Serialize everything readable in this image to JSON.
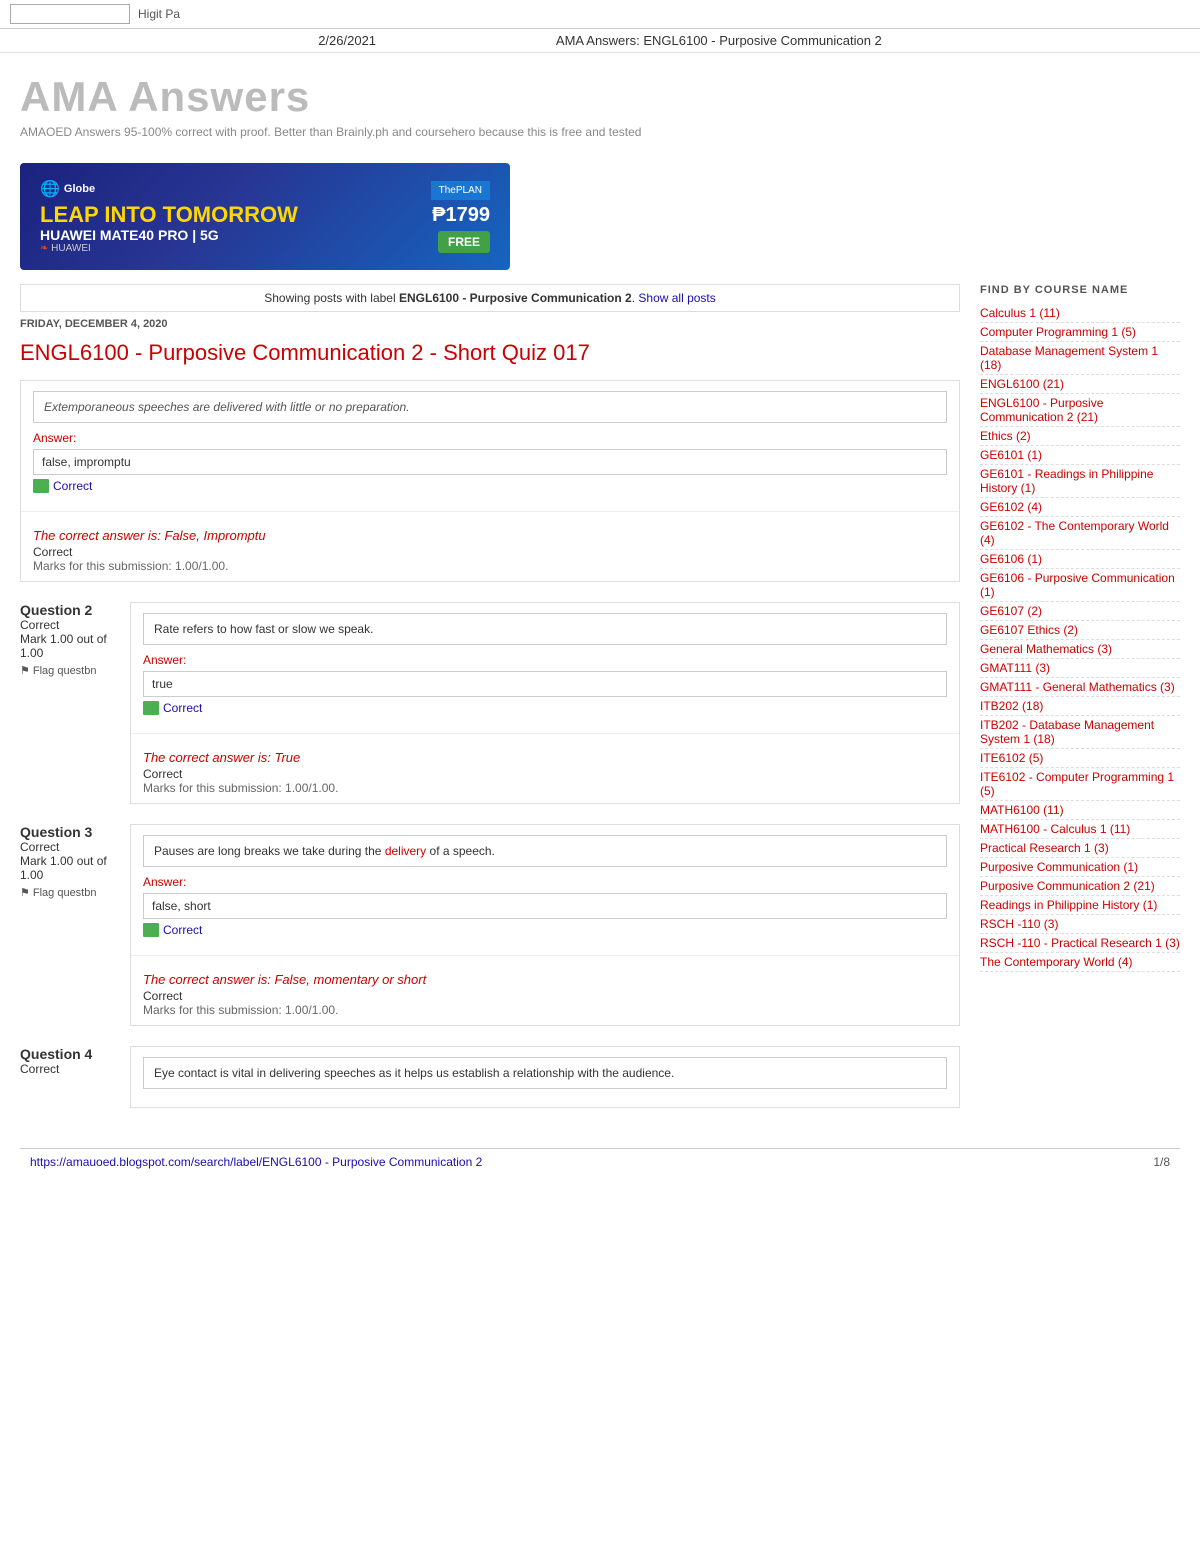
{
  "browser": {
    "title": "AMA Answers: ENGL6100 - Purposive Communication 2",
    "date": "2/26/2021",
    "url": "https://amauoed.blogspot.com/search/label/ENGL6100 - Purposive Communication 2",
    "page_num": "1/8"
  },
  "topbar": {
    "input_placeholder": "",
    "higit_pa": "Higit Pa"
  },
  "site": {
    "title": "AMA Answers",
    "subtitle": "AMAOED Answers 95-100% correct with proof. Better than Brainly.ph and coursehero because this is free and tested"
  },
  "ad": {
    "globe": "Globe",
    "huawei": "HUAWEI",
    "main_text": "LEAP INTO TOMORROW",
    "sub_text": "HUAWEI MATE40 PRO | 5G",
    "plan_label": "ThePLAN",
    "price": "₱1799",
    "free": "FREE"
  },
  "label_bar": {
    "text": "Showing posts with label",
    "label": "ENGL6100 - Purposive Communication 2",
    "show_all": "Show all posts"
  },
  "post_date": "FRIDAY, DECEMBER 4, 2020",
  "post_title": "ENGL6100 - Purposive Communication 2 - Short Quiz 017",
  "questions": [
    {
      "id": "q1",
      "num": null,
      "status": null,
      "marks": null,
      "flag": null,
      "text": "Extemporaneous speeches are delivered with little or no preparation.",
      "text_italic": true,
      "answer_label": "Answer:",
      "answer_value": "false, impromptu",
      "correct_icon": true,
      "correct_answer": "The correct answer is: False, Impromptu",
      "correct_word": "Correct",
      "marks_submission": "Marks for this submission: 1.00/1.00."
    },
    {
      "id": "q2",
      "num": "Question 2",
      "status": "Correct",
      "marks": "Mark 1.00 out of 1.00",
      "flag": "Flag questbn",
      "text": "Rate refers to how fast or slow we speak.",
      "text_italic": false,
      "answer_label": "Answer:",
      "answer_value": "true",
      "correct_icon": true,
      "correct_answer": "The correct answer is: True",
      "correct_word": "Correct",
      "marks_submission": "Marks for this submission: 1.00/1.00."
    },
    {
      "id": "q3",
      "num": "Question 3",
      "status": "Correct",
      "marks": "Mark 1.00 out of 1.00",
      "flag": "Flag questbn",
      "text_parts": [
        "Pauses are long breaks we take during the ",
        "delivery",
        " of a speech."
      ],
      "has_highlight": true,
      "answer_label": "Answer:",
      "answer_value": "false, short",
      "correct_icon": true,
      "correct_answer": "The correct answer is: False, momentary or short",
      "correct_word": "Correct",
      "marks_submission": "Marks for this submission: 1.00/1.00."
    },
    {
      "id": "q4",
      "num": "Question 4",
      "status": "Correct",
      "marks": null,
      "flag": null,
      "text": "Eye contact is vital in delivering speeches as it helps us establish a relationship with the audience.",
      "answer_label": null,
      "answer_value": null,
      "correct_icon": false
    }
  ],
  "sidebar": {
    "title": "FIND BY COURSE NAME",
    "links": [
      {
        "label": "Calculus 1 (11)"
      },
      {
        "label": "Computer Programming 1 (5)"
      },
      {
        "label": "Database Management System 1 (18)"
      },
      {
        "label": "ENGL6100 (21)"
      },
      {
        "label": "ENGL6100 - Purposive Communication 2 (21)"
      },
      {
        "label": "Ethics (2)"
      },
      {
        "label": "GE6101 (1)"
      },
      {
        "label": "GE6101 - Readings in Philippine History (1)"
      },
      {
        "label": "GE6102 (4)"
      },
      {
        "label": "GE6102 - The Contemporary World (4)"
      },
      {
        "label": "GE6106 (1)"
      },
      {
        "label": "GE6106 - Purposive Communication (1)"
      },
      {
        "label": "GE6107 (2)"
      },
      {
        "label": "GE6107 Ethics (2)"
      },
      {
        "label": "General Mathematics (3)"
      },
      {
        "label": "GMAT111 (3)"
      },
      {
        "label": "GMAT111 - General Mathematics (3)"
      },
      {
        "label": "ITB202 (18)"
      },
      {
        "label": "ITB202 - Database Management System 1 (18)"
      },
      {
        "label": "ITE6102 (5)"
      },
      {
        "label": "ITE6102 - Computer Programming 1 (5)"
      },
      {
        "label": "MATH6100 (11)"
      },
      {
        "label": "MATH6100 - Calculus 1 (11)"
      },
      {
        "label": "Practical Research 1 (3)"
      },
      {
        "label": "Purposive Communication (1)"
      },
      {
        "label": "Purposive Communication 2 (21)"
      },
      {
        "label": "Readings in Philippine History (1)"
      },
      {
        "label": "RSCH -110 (3)"
      },
      {
        "label": "RSCH -110 - Practical Research 1 (3)"
      },
      {
        "label": "The Contemporary World (4)"
      }
    ]
  },
  "bottom": {
    "url": "https://amauoed.blogspot.com/search/label/ENGL6100 - Purposive Communication 2",
    "page_num": "1/8"
  }
}
